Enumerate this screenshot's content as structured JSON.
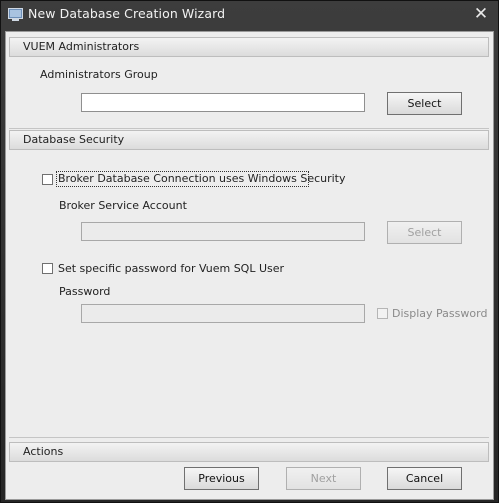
{
  "window": {
    "title": "New Database Creation Wizard",
    "close_glyph": "✕",
    "icon": "database-window-icon"
  },
  "vuem_admins": {
    "header": "VUEM Administrators",
    "group_label": "Administrators Group",
    "group_value": "",
    "select_label": "Select"
  },
  "db_security": {
    "header": "Database Security",
    "broker_windows_security_label": "Broker Database Connection uses Windows Security",
    "broker_windows_security_checked": false,
    "broker_account_label": "Broker Service Account",
    "broker_account_value": "",
    "broker_select_label": "Select",
    "sql_password_label": "Set specific password for Vuem SQL User",
    "sql_password_checked": false,
    "password_label": "Password",
    "password_value": "",
    "display_password_label": "Display Password",
    "display_password_checked": false
  },
  "actions": {
    "header": "Actions",
    "previous_label": "Previous",
    "next_label": "Next",
    "cancel_label": "Cancel"
  },
  "colors": {
    "titlebar": "#333333",
    "client_bg": "#ededed",
    "disabled_text": "#a0a0a0"
  }
}
